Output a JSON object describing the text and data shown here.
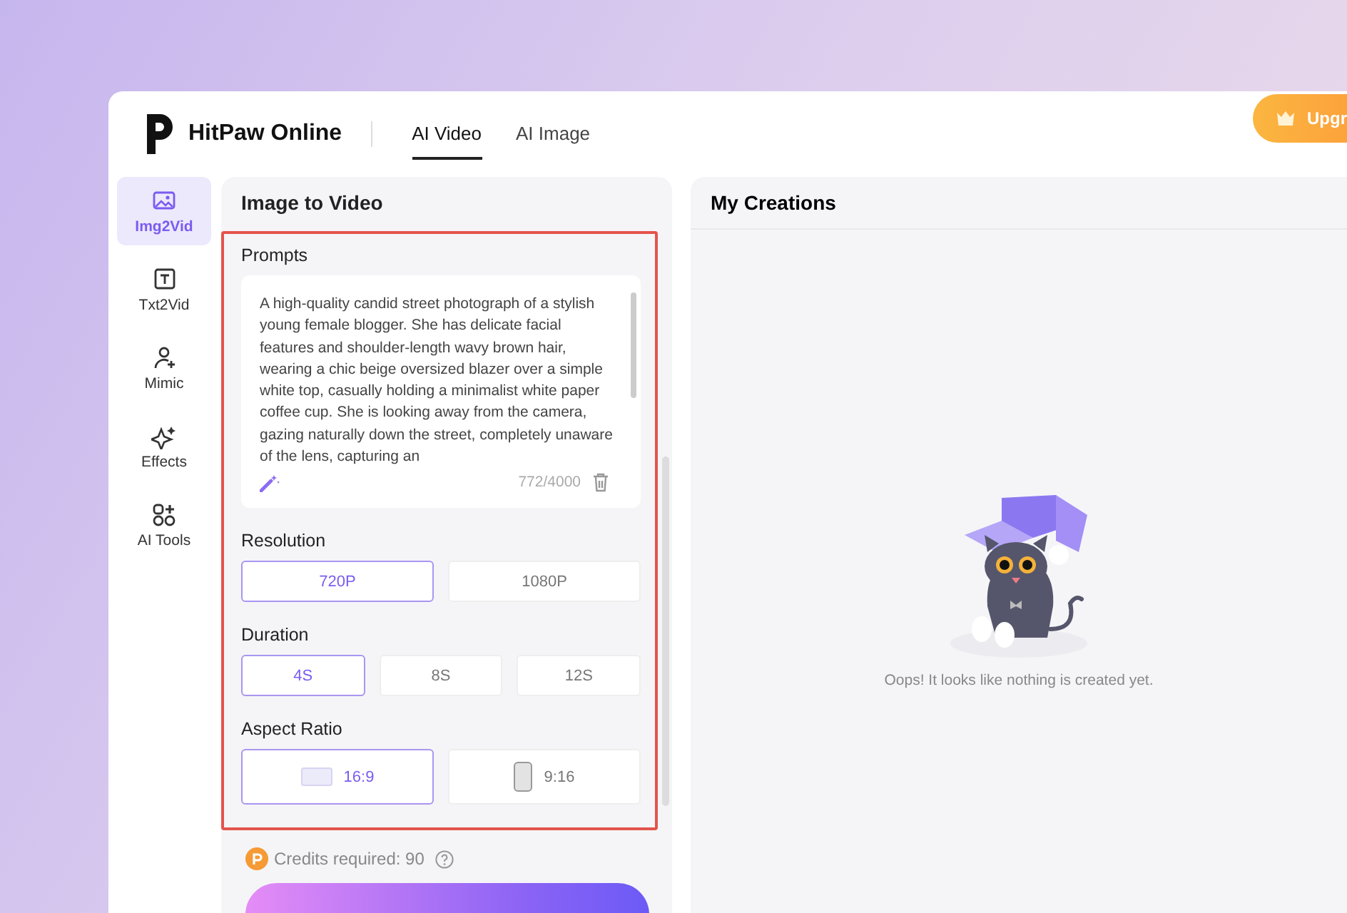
{
  "header": {
    "brand": "HitPaw Online",
    "tabs": [
      {
        "label": "AI Video",
        "selected": true
      },
      {
        "label": "AI Image",
        "selected": false
      }
    ],
    "upgrade_button": "Upgr"
  },
  "sidebar": {
    "items": [
      {
        "label": "Img2Vid",
        "kind": "image",
        "selected": true
      },
      {
        "label": "Txt2Vid",
        "kind": "text",
        "selected": false
      },
      {
        "label": "Mimic",
        "kind": "person",
        "selected": false
      },
      {
        "label": "Effects",
        "kind": "sparkle",
        "selected": false
      },
      {
        "label": "AI Tools",
        "kind": "tools",
        "selected": false
      }
    ]
  },
  "panel": {
    "title": "Image to Video",
    "prompts": {
      "label": "Prompts",
      "value": "A high-quality candid street photograph of a stylish young female blogger. She has delicate facial features and shoulder-length wavy brown hair, wearing a chic beige oversized blazer over a simple white top, casually holding a minimalist white paper coffee cup. She is looking away from the camera, gazing naturally down the street, completely unaware of the lens, capturing an",
      "counter": "772/4000"
    },
    "options": [
      {
        "label": "Resolution",
        "choices": [
          {
            "label": "720P",
            "kind": "plain",
            "selected": true
          },
          {
            "label": "1080P",
            "kind": "plain",
            "selected": false
          }
        ]
      },
      {
        "label": "Duration",
        "choices": [
          {
            "label": "4S",
            "kind": "plain",
            "selected": true
          },
          {
            "label": "8S",
            "kind": "plain",
            "selected": false
          },
          {
            "label": "12S",
            "kind": "plain",
            "selected": false
          }
        ]
      },
      {
        "label": "Aspect Ratio",
        "choices": [
          {
            "label": "16:9",
            "kind": "landscape",
            "selected": true
          },
          {
            "label": "9:16",
            "kind": "portrait",
            "selected": false
          }
        ]
      }
    ],
    "credits": "Credits required: 90"
  },
  "creations": {
    "title": "My Creations",
    "empty_message": "Oops! It looks like nothing is created yet."
  }
}
